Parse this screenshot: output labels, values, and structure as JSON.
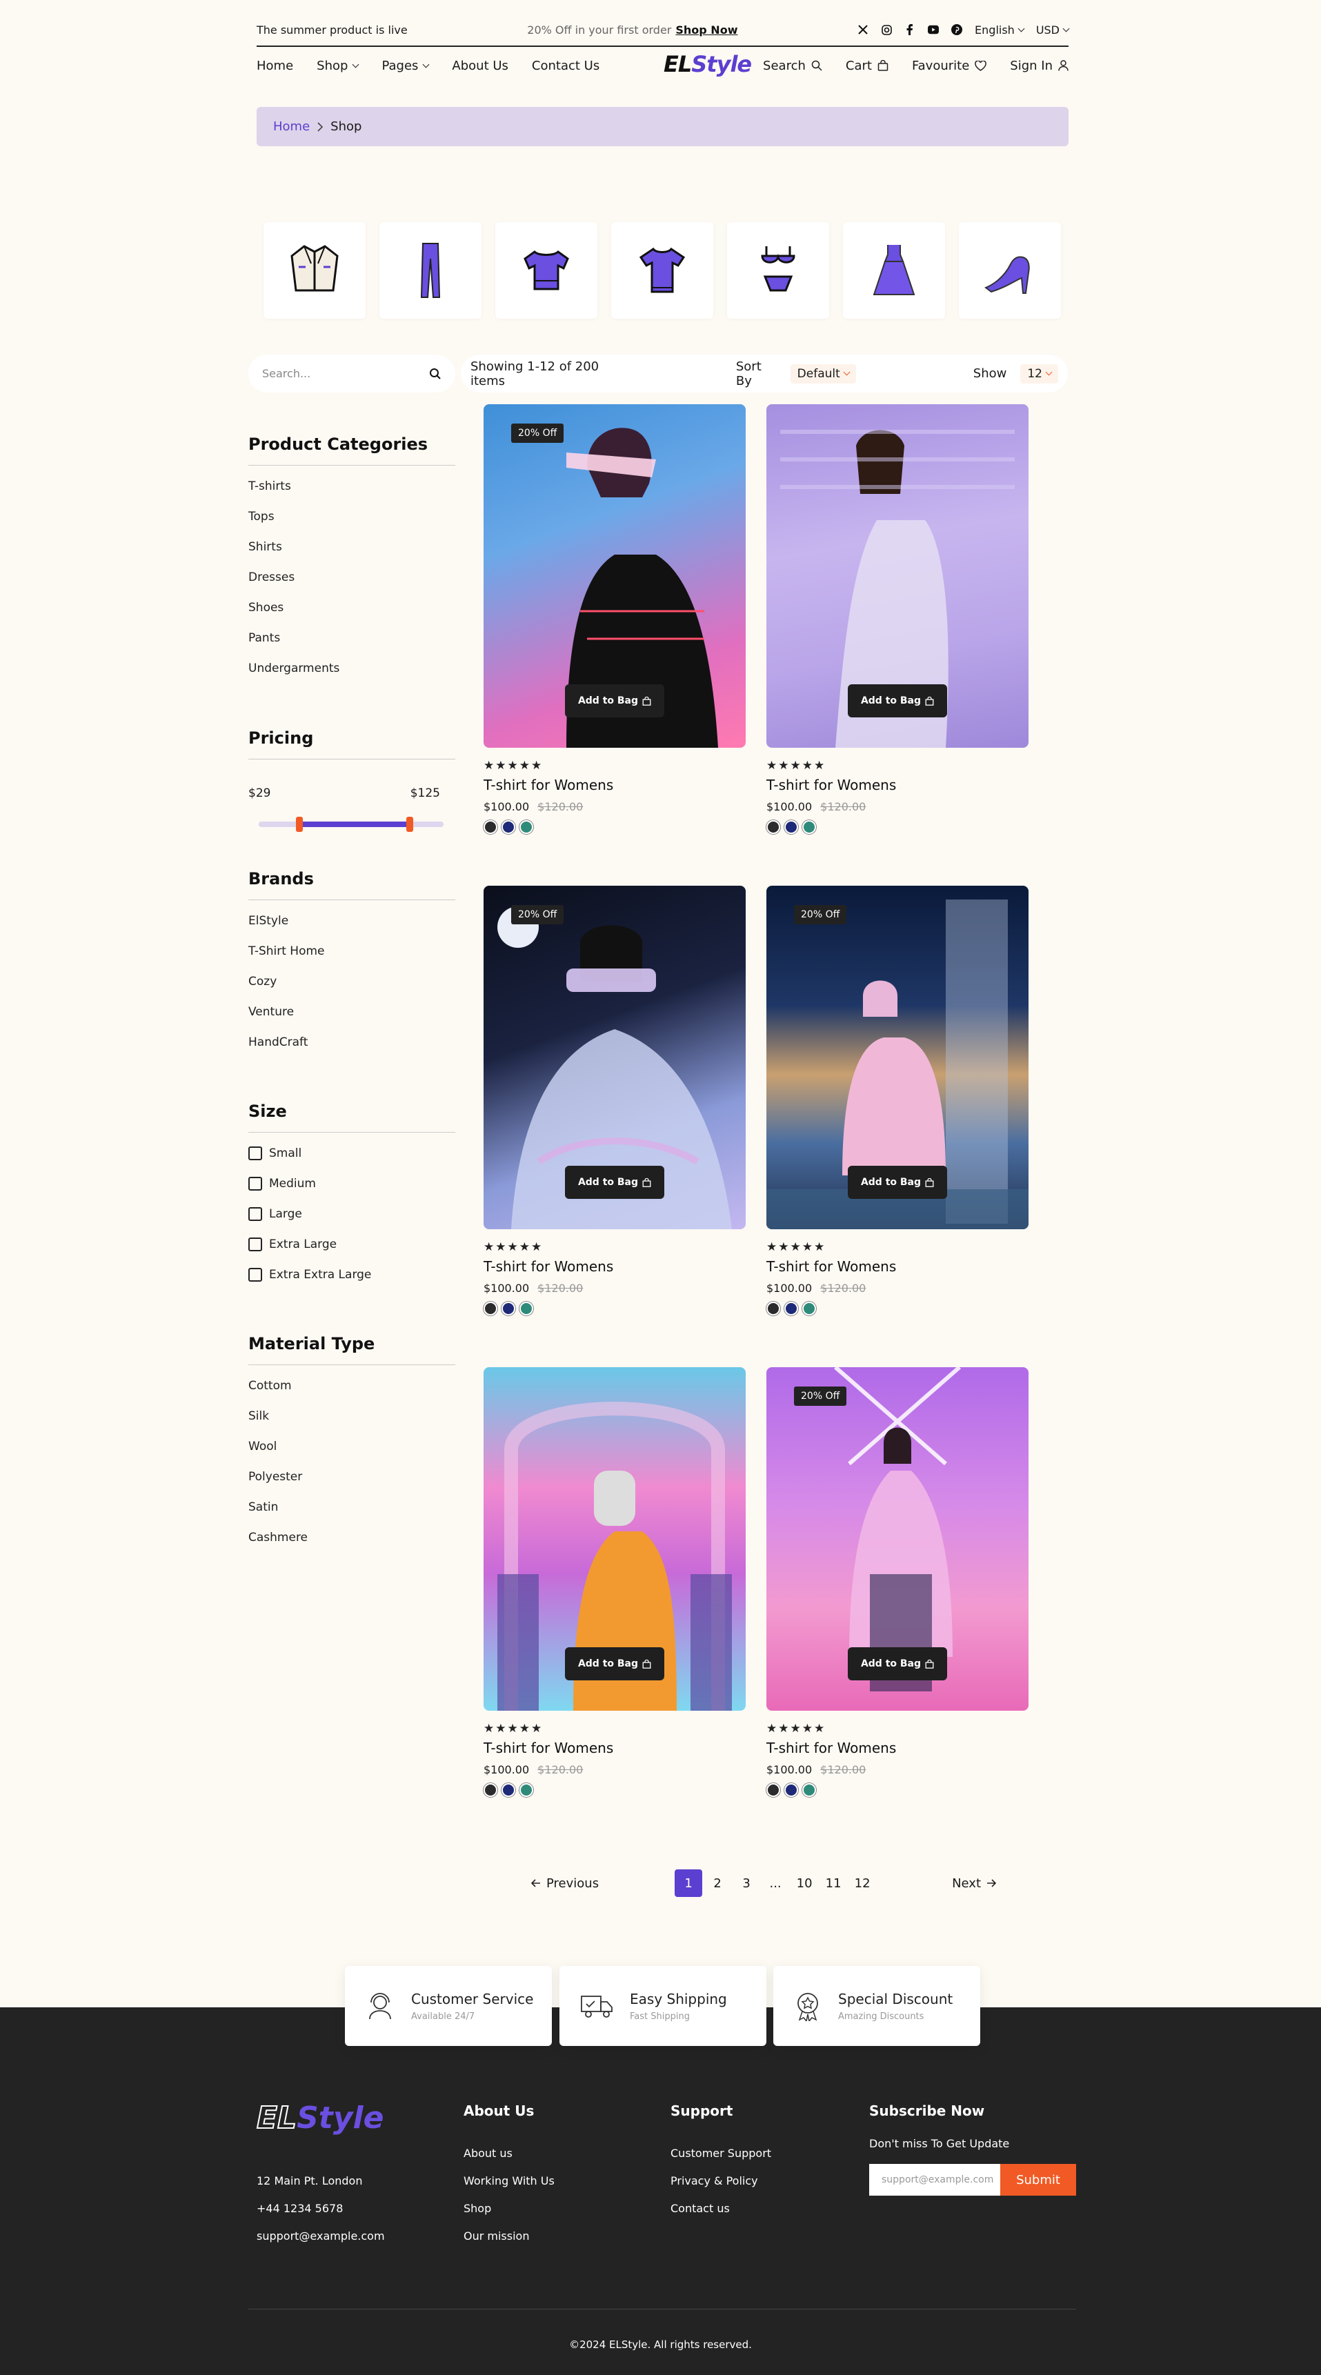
{
  "topbar": {
    "promo_left": "The summer product is live",
    "promo_mid": "20% Off in your first order",
    "promo_link": "Shop Now",
    "language": "English",
    "currency": "USD",
    "social": [
      "x-icon",
      "instagram-icon",
      "facebook-icon",
      "youtube-icon",
      "pinterest-icon"
    ]
  },
  "nav": {
    "home": "Home",
    "shop": "Shop",
    "pages": "Pages",
    "about": "About Us",
    "contact": "Contact Us",
    "logo_a": "EL",
    "logo_b": "Style",
    "search": "Search",
    "cart": "Cart",
    "favourite": "Favourite",
    "signin": "Sign In"
  },
  "breadcrumb": {
    "home": "Home",
    "current": "Shop"
  },
  "categories": [
    "jacket-icon",
    "pants-icon",
    "top-icon",
    "tshirt-icon",
    "undergarments-icon",
    "dress-icon",
    "heels-icon"
  ],
  "search": {
    "placeholder": "Search..."
  },
  "toolbar": {
    "showing": "Showing 1-12 of 200 items",
    "sort_label": "Sort By",
    "sort_value": "Default",
    "show_label": "Show",
    "show_value": "12"
  },
  "sidebar": {
    "categories_title": "Product Categories",
    "categories": [
      "T-shirts",
      "Tops",
      "Shirts",
      "Dresses",
      "Shoes",
      "Pants",
      "Undergarments"
    ],
    "pricing_title": "Pricing",
    "price_min": "$29",
    "price_max": "$125",
    "brands_title": "Brands",
    "brands": [
      "ElStyle",
      "T-Shirt Home",
      "Cozy",
      "Venture",
      "HandCraft"
    ],
    "size_title": "Size",
    "sizes": [
      "Small",
      "Medium",
      "Large",
      "Extra Large",
      "Extra Extra Large"
    ],
    "material_title": "Material Type",
    "materials": [
      "Cottom",
      "Silk",
      "Wool",
      "Polyester",
      "Satin",
      "Cashmere"
    ]
  },
  "products": [
    {
      "badge": "20% Off",
      "button": "Add to Bag",
      "stars": "★★★★★",
      "title": "T-shirt for Womens",
      "price": "$100.00",
      "old_price": "$120.00",
      "colors": [
        "#2b2b2b",
        "#1e2a78",
        "#2e8b7a"
      ]
    },
    {
      "badge": "",
      "button": "Add to Bag",
      "stars": "★★★★★",
      "title": "T-shirt for Womens",
      "price": "$100.00",
      "old_price": "$120.00",
      "colors": [
        "#2b2b2b",
        "#1e2a78",
        "#2e8b7a"
      ]
    },
    {
      "badge": "20% Off",
      "button": "Add to Bag",
      "stars": "★★★★★",
      "title": "T-shirt for Womens",
      "price": "$100.00",
      "old_price": "$120.00",
      "colors": [
        "#2b2b2b",
        "#1e2a78",
        "#2e8b7a"
      ]
    },
    {
      "badge": "20% Off",
      "button": "Add to Bag",
      "stars": "★★★★★",
      "title": "T-shirt for Womens",
      "price": "$100.00",
      "old_price": "$120.00",
      "colors": [
        "#2b2b2b",
        "#1e2a78",
        "#2e8b7a"
      ]
    },
    {
      "badge": "",
      "button": "Add to Bag",
      "stars": "★★★★★",
      "title": "T-shirt for Womens",
      "price": "$100.00",
      "old_price": "$120.00",
      "colors": [
        "#2b2b2b",
        "#1e2a78",
        "#2e8b7a"
      ]
    },
    {
      "badge": "20% Off",
      "button": "Add to Bag",
      "stars": "★★★★★",
      "title": "T-shirt for Womens",
      "price": "$100.00",
      "old_price": "$120.00",
      "colors": [
        "#2b2b2b",
        "#1e2a78",
        "#2e8b7a"
      ]
    }
  ],
  "pagination": {
    "prev": "Previous",
    "next": "Next",
    "pages": [
      "1",
      "2",
      "3",
      "...",
      "10",
      "11",
      "12"
    ],
    "active": "1"
  },
  "features": [
    {
      "title": "Customer Service",
      "sub": "Available 24/7",
      "icon": "headset-icon"
    },
    {
      "title": "Easy Shipping",
      "sub": "Fast Shipping",
      "icon": "truck-icon"
    },
    {
      "title": "Special Discount",
      "sub": "Amazing Discounts",
      "icon": "award-icon"
    }
  ],
  "footer": {
    "logo_a": "EL",
    "logo_b": "Style",
    "address": "12 Main Pt. London",
    "phone": "+44 1234 5678",
    "email": "support@example.com",
    "about_title": "About Us",
    "about_links": [
      "About us",
      "Working With Us",
      "Shop",
      "Our mission"
    ],
    "support_title": "Support",
    "support_links": [
      "Customer Support",
      "Privacy & Policy",
      "Contact us"
    ],
    "subscribe_title": "Subscribe Now",
    "subscribe_text": "Don't miss To Get Update",
    "subscribe_placeholder": "support@example.com",
    "subscribe_button": "Submit",
    "copyright": "©2024 ELStyle. All rights reserved."
  },
  "colors": {
    "accent": "#5b3fd0",
    "orange": "#f15a24",
    "bg": "#fdf9f3",
    "footer": "#232323"
  }
}
